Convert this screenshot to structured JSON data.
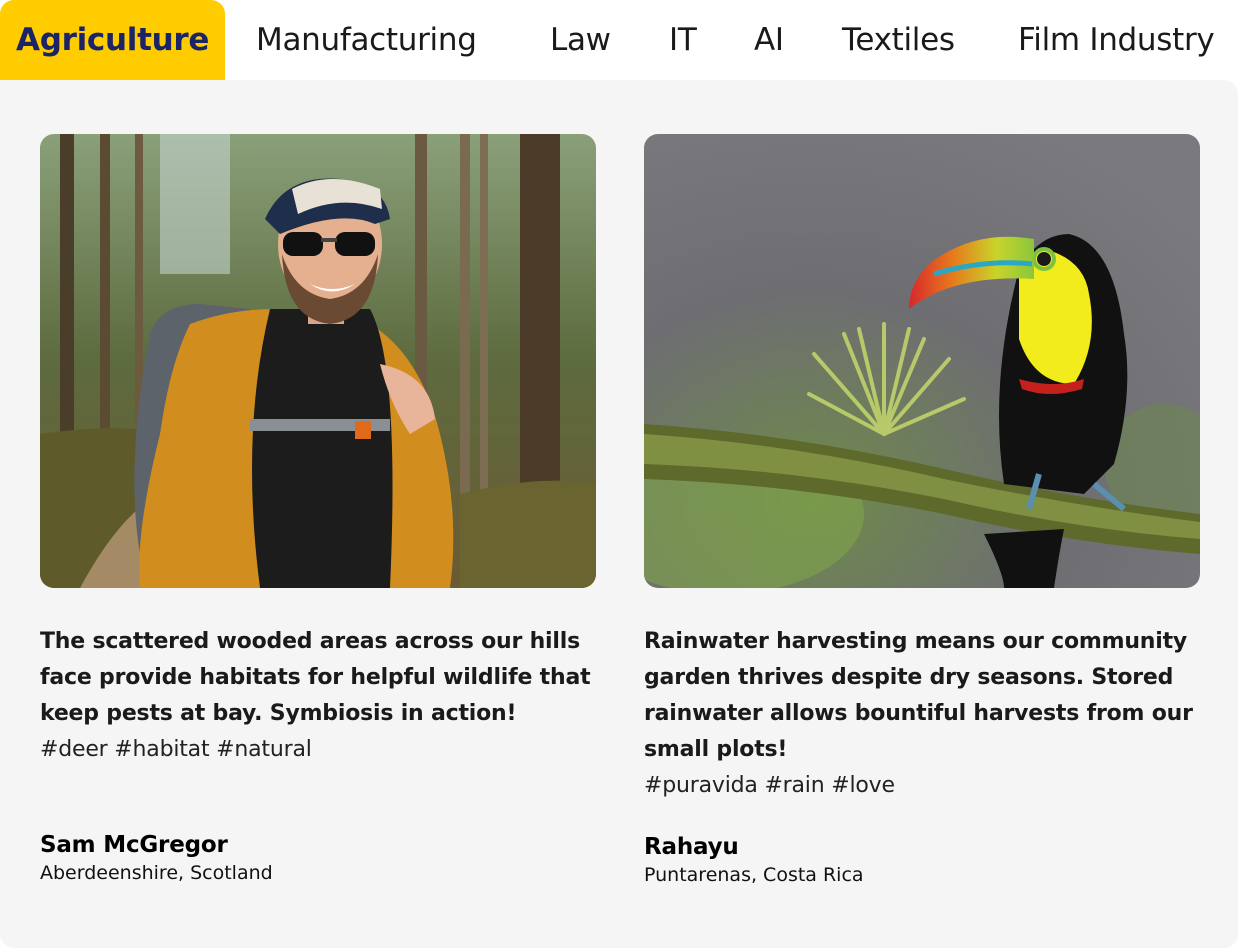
{
  "tabs": [
    {
      "label": "Agriculture",
      "active": true
    },
    {
      "label": "Manufacturing",
      "active": false
    },
    {
      "label": "Law",
      "active": false
    },
    {
      "label": "IT",
      "active": false
    },
    {
      "label": "AI",
      "active": false
    },
    {
      "label": "Textiles",
      "active": false
    },
    {
      "label": "Film Industry",
      "active": false
    }
  ],
  "colors": {
    "accent": "#ffcc00",
    "active_text": "#1b2466",
    "panel_bg": "#f5f5f5"
  },
  "cards": [
    {
      "image": "hiker-in-forest-photo",
      "quote": "The scattered wooded areas across our hills face provide habitats for helpful wildlife that keep pests at bay. Symbiosis in action!",
      "tags": "#deer #habitat #natural",
      "name": "Sam McGregor",
      "location": "Aberdeenshire, Scotland"
    },
    {
      "image": "toucan-on-branch-photo",
      "quote": "Rainwater harvesting means our community garden thrives despite dry seasons. Stored rainwater allows bountiful harvests from our small plots!",
      "tags": "#puravida #rain #love",
      "name": "Rahayu",
      "location": "Puntarenas, Costa Rica"
    }
  ]
}
